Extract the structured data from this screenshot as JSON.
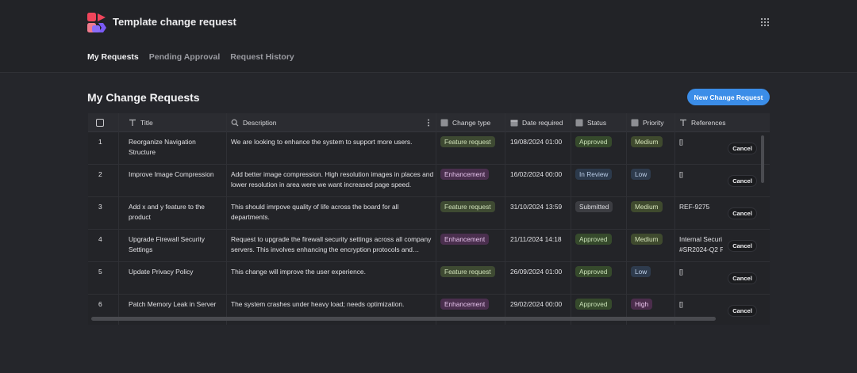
{
  "app": {
    "title": "Template change request"
  },
  "nav": {
    "tabs": [
      "My Requests",
      "Pending Approval",
      "Request History"
    ],
    "active": 0
  },
  "page": {
    "section_title": "My Change Requests",
    "new_button_label": "New Change Request"
  },
  "table": {
    "headers": {
      "title": "Title",
      "description": "Description",
      "change_type": "Change type",
      "date_required": "Date required",
      "status": "Status",
      "priority": "Priority",
      "references": "References"
    },
    "cancel_label": "Cancel",
    "rows": [
      {
        "index": "1",
        "title": "Reorganize Navigation Structure",
        "description": "We are looking to enhance the system to support more users.",
        "change_type": "Feature request",
        "date": "19/08/2024 01:00",
        "status": "Approved",
        "priority": "Medium",
        "references": [
          "[]"
        ]
      },
      {
        "index": "2",
        "title": "Improve Image Compression",
        "description": "Add better image compression. High resolution images in places and lower resolution in area were we want increased page speed.",
        "change_type": "Enhancement",
        "date": "16/02/2024 00:00",
        "status": "In Review",
        "priority": "Low",
        "references": [
          "[]"
        ]
      },
      {
        "index": "3",
        "title": "Add x and y feature to the product",
        "description": "This should imrpove quality of life across the board for all departments.",
        "change_type": "Feature request",
        "date": "31/10/2024 13:59",
        "status": "Submitted",
        "priority": "Medium",
        "references": [
          "REF-9275"
        ]
      },
      {
        "index": "4",
        "title": "Upgrade Firewall Security Settings",
        "description": "Request to upgrade the firewall security settings across all company servers. This involves enhancing the encryption protocols and…",
        "change_type": "Enhancement",
        "date": "21/11/2024 14:18",
        "status": "Approved",
        "priority": "Medium",
        "references": [
          "Internal Securi",
          "#SR2024-Q2 Fi"
        ]
      },
      {
        "index": "5",
        "title": "Update Privacy Policy",
        "description": "This change will improve the user experience.",
        "change_type": "Feature request",
        "date": "26/09/2024 01:00",
        "status": "Approved",
        "priority": "Low",
        "references": [
          "[]"
        ]
      },
      {
        "index": "6",
        "title": "Patch Memory Leak in Server",
        "description": "The system crashes under heavy load; needs optimization.",
        "change_type": "Enhancement",
        "date": "29/02/2024 00:00",
        "status": "Approved",
        "priority": "High",
        "references": [
          "[]"
        ]
      }
    ]
  },
  "icons": {
    "logo": "app-logo",
    "menu": "grid-dots-icon",
    "title_col": "text-type-icon",
    "description_col": "search-icon",
    "change_type_col": "select-box-icon",
    "date_col": "calendar-icon",
    "status_col": "select-box-icon",
    "priority_col": "select-box-icon",
    "references_col": "text-type-icon"
  },
  "colors": {
    "accent": "#3b8de8",
    "background": "#25262b"
  }
}
